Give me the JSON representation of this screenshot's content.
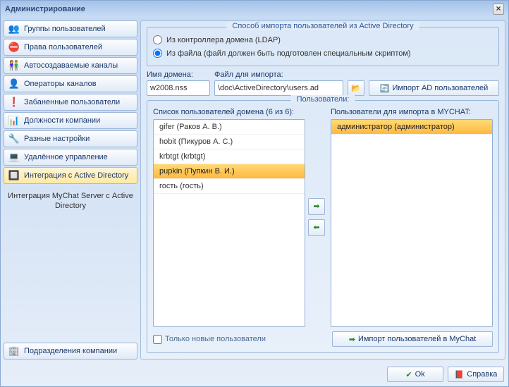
{
  "window": {
    "title": "Администрирование"
  },
  "sidebar": {
    "items": [
      {
        "label": "Группы пользователей",
        "icon": "👥"
      },
      {
        "label": "Права пользователей",
        "icon": "⛔"
      },
      {
        "label": "Автосоздаваемые каналы",
        "icon": "👫"
      },
      {
        "label": "Операторы каналов",
        "icon": "👤"
      },
      {
        "label": "Забаненные пользователи",
        "icon": "❗"
      },
      {
        "label": "Должности компании",
        "icon": "📊"
      },
      {
        "label": "Разные настройки",
        "icon": "🔧"
      },
      {
        "label": "Удалённое управление",
        "icon": "💻"
      },
      {
        "label": "Интеграция с Active Directory",
        "icon": "🔲"
      }
    ],
    "desc": "Интеграция MyChat Server с Active Directory",
    "bottom": {
      "label": "Подразделения компании",
      "icon": "🏢"
    }
  },
  "import_method": {
    "title": "Способ импорта пользователей из Active Directory",
    "option_ldap": "Из контроллера домена (LDAP)",
    "option_file": "Из файла (файл должен быть подготовлен специальным скриптом)"
  },
  "domain": {
    "label": "Имя домена:",
    "value": "w2008.nss"
  },
  "file": {
    "label": "Файл для импорта:",
    "value": "\\doc\\ActiveDirectory\\users.ad"
  },
  "import_ad_btn": "Импорт AD пользователей",
  "users_panel": {
    "title": "Пользователи:",
    "left_label": "Список пользователей домена (6 из 6):",
    "right_label": "Пользователи для импорта в MYCHAT:",
    "left": [
      "gifer (Раков А. В.)",
      "hobit (Пикуров А. С.)",
      "krbtgt (krbtgt)",
      "pupkin (Пупкин В. И.)",
      "гость (гость)"
    ],
    "right": [
      "администратор (администратор)"
    ],
    "only_new": "Только новые пользователи",
    "import_mychat": "Импорт пользователей в MyChat"
  },
  "footer": {
    "ok": "Ok",
    "help": "Справка"
  }
}
